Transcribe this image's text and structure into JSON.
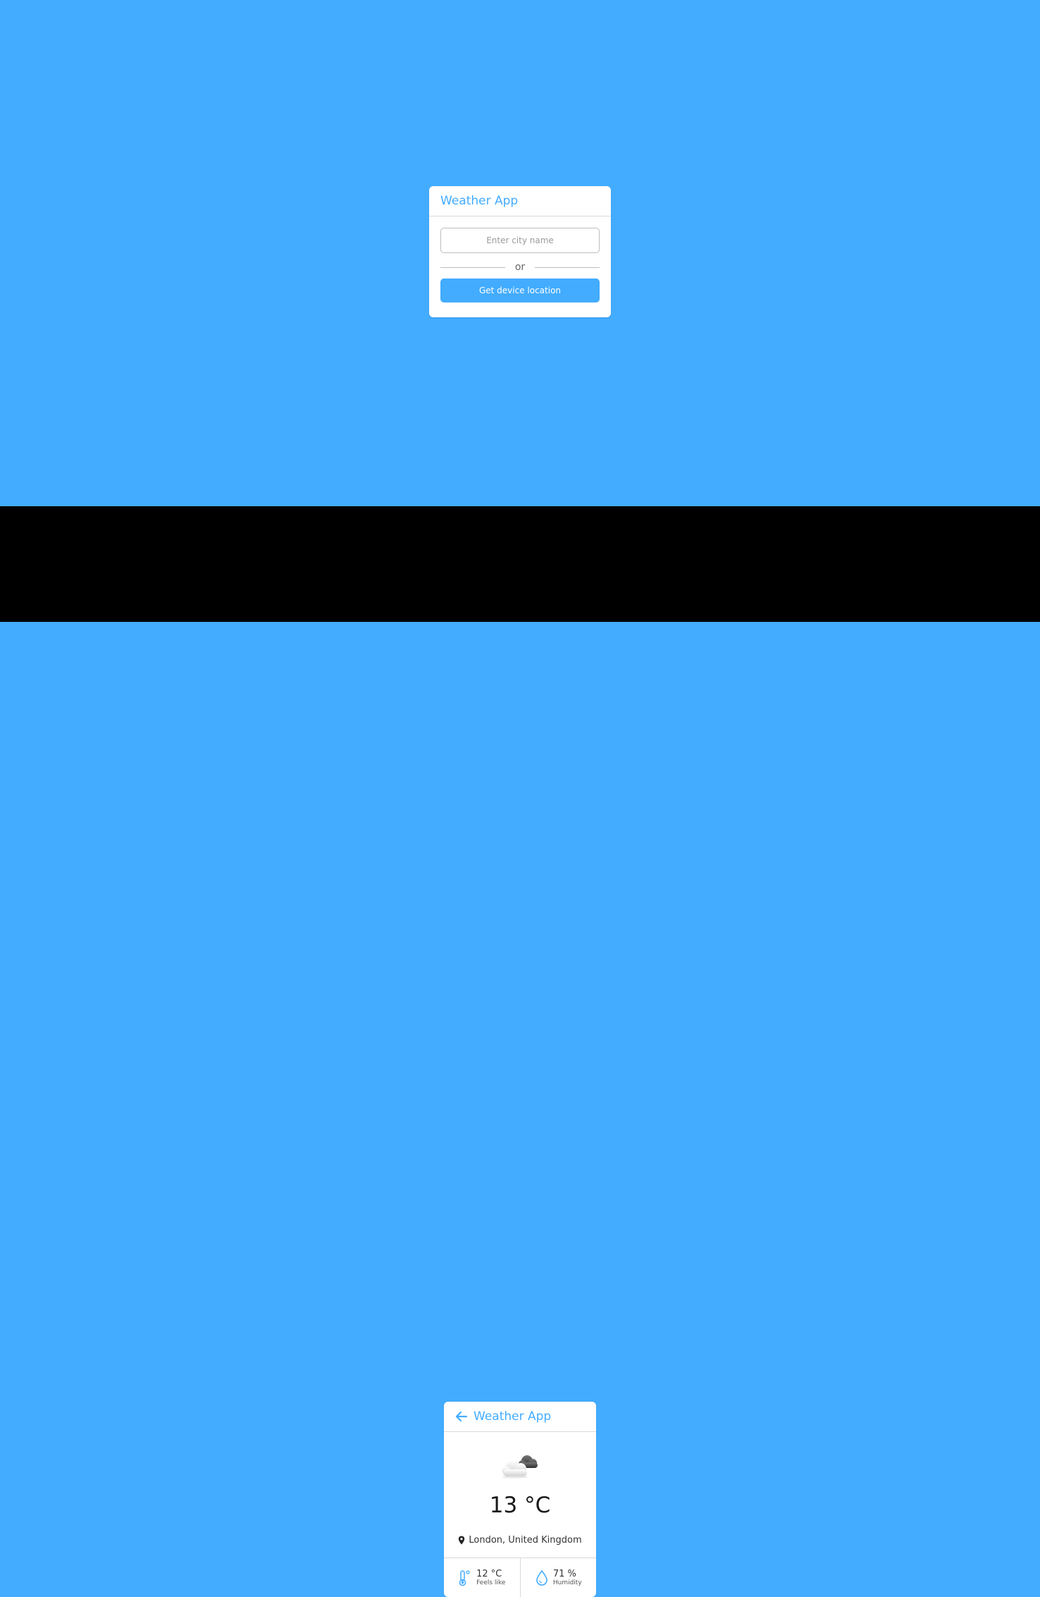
{
  "search_screen": {
    "title": "Weather App",
    "city_input": {
      "placeholder": "Enter city name",
      "value": ""
    },
    "divider_text": "or",
    "location_button_label": "Get device location"
  },
  "weather_screen": {
    "title": "Weather App",
    "icon": "cloudy-icon",
    "temperature": "13 °C",
    "location": "London, United Kingdom",
    "feels_like": {
      "value": "12 °C",
      "label": "Feels like",
      "icon": "thermometer-icon"
    },
    "humidity": {
      "value": "71 %",
      "label": "Humidity",
      "icon": "droplet-icon"
    }
  },
  "colors": {
    "background": "#43acff",
    "accent": "#43acff",
    "band": "#000000",
    "card": "#ffffff"
  }
}
